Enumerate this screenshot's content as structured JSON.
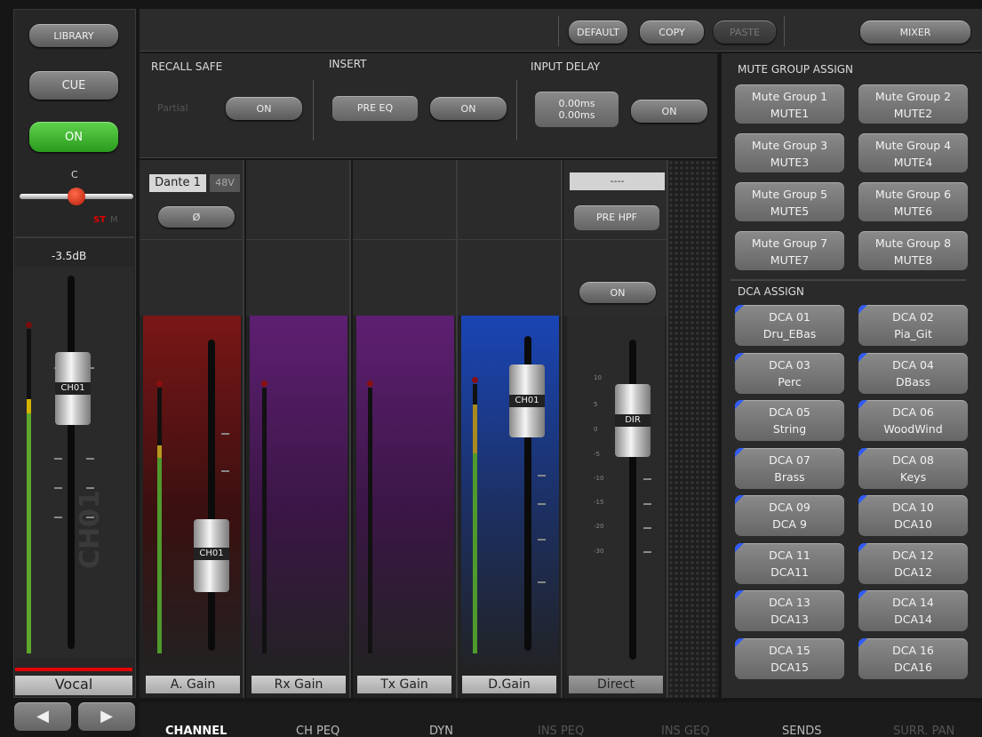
{
  "left": {
    "library": "LIBRARY",
    "cue": "CUE",
    "on": "ON",
    "pan_center": "C",
    "st": "ST",
    "m": "M",
    "level": "-3.5dB",
    "fader_cap": "CH01",
    "watermark": "CH01",
    "channel_name": "Vocal",
    "channel_color": "#e00000"
  },
  "topbar": {
    "default": "DEFAULT",
    "copy": "COPY",
    "paste": "PASTE",
    "mixer": "MIXER"
  },
  "recall_safe": {
    "title": "RECALL SAFE",
    "partial": "Partial",
    "on": "ON"
  },
  "insert": {
    "title": "INSERT",
    "pre_eq": "PRE EQ",
    "on": "ON"
  },
  "input_delay": {
    "title": "INPUT DELAY",
    "value1": "0.00ms",
    "value2": "0.00ms",
    "on": "ON"
  },
  "strips": {
    "dante": "Dante 1",
    "p48v": "48V",
    "phase": "Ø",
    "input_box": "----",
    "pre_hpf": "PRE HPF",
    "direct_on": "ON",
    "a_gain": "A. Gain",
    "rx_gain": "Rx Gain",
    "tx_gain": "Tx Gain",
    "d_gain": "D.Gain",
    "direct": "Direct",
    "cap_a": "CH01",
    "cap_d": "CH01",
    "cap_dir": "DIR",
    "scale": [
      "10",
      "5",
      "0",
      "-5",
      "-10",
      "-15",
      "-20",
      "-30"
    ]
  },
  "mute_group": {
    "title": "MUTE GROUP ASSIGN",
    "items": [
      {
        "name": "Mute Group 1",
        "sub": "MUTE1"
      },
      {
        "name": "Mute Group 2",
        "sub": "MUTE2"
      },
      {
        "name": "Mute Group 3",
        "sub": "MUTE3"
      },
      {
        "name": "Mute Group 4",
        "sub": "MUTE4"
      },
      {
        "name": "Mute Group 5",
        "sub": "MUTE5"
      },
      {
        "name": "Mute Group 6",
        "sub": "MUTE6"
      },
      {
        "name": "Mute Group 7",
        "sub": "MUTE7"
      },
      {
        "name": "Mute Group 8",
        "sub": "MUTE8"
      }
    ]
  },
  "dca": {
    "title": "DCA ASSIGN",
    "items": [
      {
        "name": "DCA 01",
        "sub": "Dru_EBas"
      },
      {
        "name": "DCA 02",
        "sub": "Pia_Git"
      },
      {
        "name": "DCA 03",
        "sub": "Perc"
      },
      {
        "name": "DCA 04",
        "sub": "DBass"
      },
      {
        "name": "DCA 05",
        "sub": "String"
      },
      {
        "name": "DCA 06",
        "sub": "WoodWind"
      },
      {
        "name": "DCA 07",
        "sub": "Brass"
      },
      {
        "name": "DCA 08",
        "sub": "Keys"
      },
      {
        "name": "DCA 09",
        "sub": "DCA 9"
      },
      {
        "name": "DCA 10",
        "sub": "DCA10"
      },
      {
        "name": "DCA 11",
        "sub": "DCA11"
      },
      {
        "name": "DCA 12",
        "sub": "DCA12"
      },
      {
        "name": "DCA 13",
        "sub": "DCA13"
      },
      {
        "name": "DCA 14",
        "sub": "DCA14"
      },
      {
        "name": "DCA 15",
        "sub": "DCA15"
      },
      {
        "name": "DCA 16",
        "sub": "DCA16"
      }
    ]
  },
  "tabs": [
    "CHANNEL",
    "CH PEQ",
    "DYN",
    "INS PEQ",
    "INS GEQ",
    "SENDS",
    "SURR. PAN"
  ]
}
